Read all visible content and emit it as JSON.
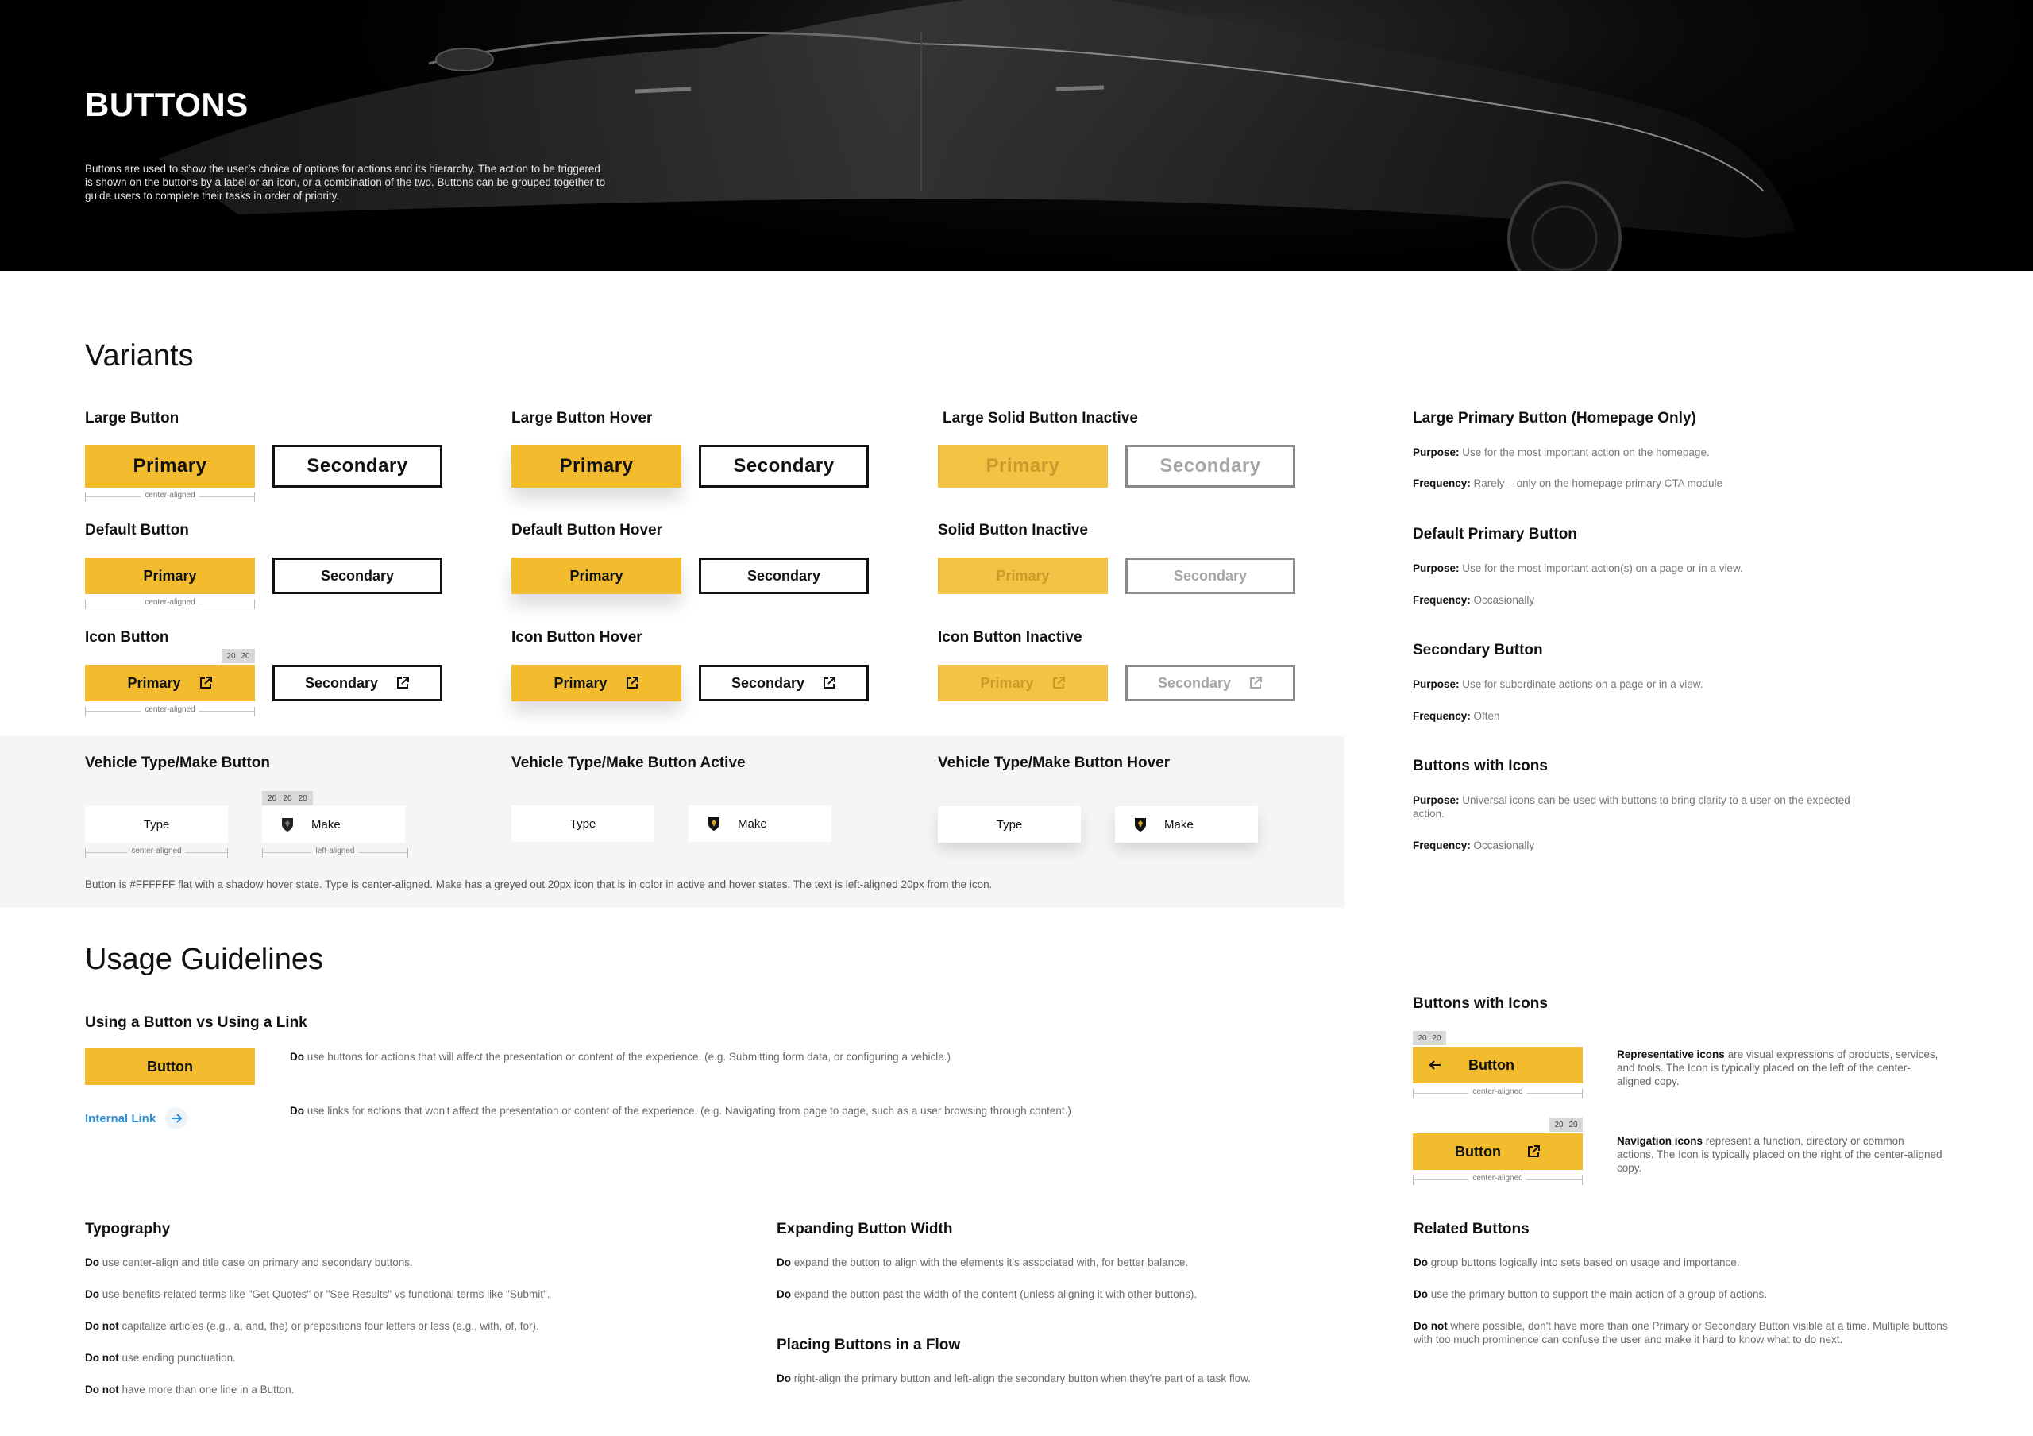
{
  "hero": {
    "title": "BUTTONS",
    "description": "Buttons are used to show the user’s choice of options for actions and its hierarchy. The action to be triggered is shown on the buttons by a label or an icon, or a combination of the two. Buttons can be grouped together to guide users to complete their tasks in order of priority."
  },
  "variants": {
    "heading": "Variants",
    "primary_label": "Primary",
    "secondary_label": "Secondary",
    "center_aligned": "center-aligned",
    "left_aligned": "left-aligned",
    "size_20": "20",
    "groups": {
      "large": "Large Button",
      "large_hover": "Large Button Hover",
      "large_inactive": "Large Solid Button Inactive",
      "default": "Default Button",
      "default_hover": "Default Button Hover",
      "default_inactive": "Solid Button Inactive",
      "icon": "Icon Button",
      "icon_hover": "Icon Button Hover",
      "icon_inactive": "Icon Button Inactive"
    },
    "vehicle": {
      "title": "Vehicle Type/Make Button",
      "title_active": "Vehicle Type/Make Button Active",
      "title_hover": "Vehicle Type/Make Button Hover",
      "type_label": "Type",
      "make_label": "Make",
      "note": "Button is #FFFFFF flat with a shadow hover state. Type is center-aligned. Make has a greyed out 20px icon that is in color in active and hover states. The text is left-aligned 20px from the icon."
    }
  },
  "specs": [
    {
      "title": "Large Primary Button (Homepage Only)",
      "purpose": "Use for the most important action on the homepage.",
      "frequency": "Rarely – only on the homepage primary CTA module"
    },
    {
      "title": "Default Primary Button",
      "purpose": "Use for the most important action(s) on a page or in a view.",
      "frequency": "Occasionally"
    },
    {
      "title": "Secondary Button",
      "purpose": "Use for subordinate actions on a page or in a view.",
      "frequency": "Often"
    },
    {
      "title": "Buttons with Icons",
      "purpose": "Universal icons can be used with buttons to bring clarity to a user on the expected action.",
      "frequency": "Occasionally"
    }
  ],
  "spec_labels": {
    "purpose": "Purpose:",
    "frequency": "Frequency:"
  },
  "usage": {
    "heading": "Usage Guidelines",
    "button_vs_link": {
      "title": "Using a Button vs Using a Link",
      "button_label": "Button",
      "link_label": "Internal Link",
      "do_label": "Do",
      "button_text": "use buttons for actions that will affect the presentation or content of the experience. (e.g. Submitting form data, or configuring a vehicle.)",
      "link_text": "use links for actions that won't affect the presentation or content of the experience. (e.g. Navigating from page to page, such as a user browsing through content.)"
    },
    "icons": {
      "title": "Buttons with Icons",
      "button_label": "Button",
      "rep_bold": "Representative icons",
      "rep_text": " are visual expressions of products, services, and tools. The Icon is typically placed on the left of the center-aligned copy.",
      "nav_bold": "Navigation icons",
      "nav_text": " represent a function, directory or common actions. The Icon is typically placed on the right of the center-aligned copy."
    },
    "typography": {
      "title": "Typography",
      "items": [
        {
          "lead": "Do",
          "text": " use center-align and title case on primary and secondary buttons."
        },
        {
          "lead": "Do",
          "text": " use benefits-related terms like \"Get Quotes\" or \"See Results\" vs functional terms like \"Submit\"."
        },
        {
          "lead": "Do not",
          "text": " capitalize articles (e.g., a, and, the) or prepositions four letters or less (e.g., with, of, for)."
        },
        {
          "lead": "Do not",
          "text": " use ending punctuation."
        },
        {
          "lead": "Do not",
          "text": " have more than one line in a Button."
        }
      ]
    },
    "expanding": {
      "title": "Expanding Button Width",
      "items": [
        {
          "lead": "Do",
          "text": " expand the button to align with the elements it's associated with, for better balance."
        },
        {
          "lead": "Do",
          "text": " expand the button past the width of the content (unless aligning it with other buttons)."
        }
      ]
    },
    "flow": {
      "title": "Placing Buttons in a Flow",
      "items": [
        {
          "lead": "Do",
          "text": " right-align the primary button and left-align the secondary button when they're part of a task flow."
        }
      ]
    },
    "related": {
      "title": "Related Buttons",
      "items": [
        {
          "lead": "Do",
          "text": " group buttons logically into sets based on usage and importance."
        },
        {
          "lead": "Do",
          "text": " use the primary button to support the main action of a group of actions."
        },
        {
          "lead": "Do not",
          "text": " where possible, don't have more than one Primary or Secondary Button visible at a time. Multiple buttons with too much prominence can confuse the user and make it hard to know what to do next."
        }
      ]
    }
  },
  "colors": {
    "accent": "#f3bc2e",
    "link": "#2a8fd6",
    "band": "#f5f5f5"
  },
  "icons": [
    "external-link-icon",
    "arrow-right-icon",
    "arrow-left-icon",
    "shield-logo-icon"
  ]
}
